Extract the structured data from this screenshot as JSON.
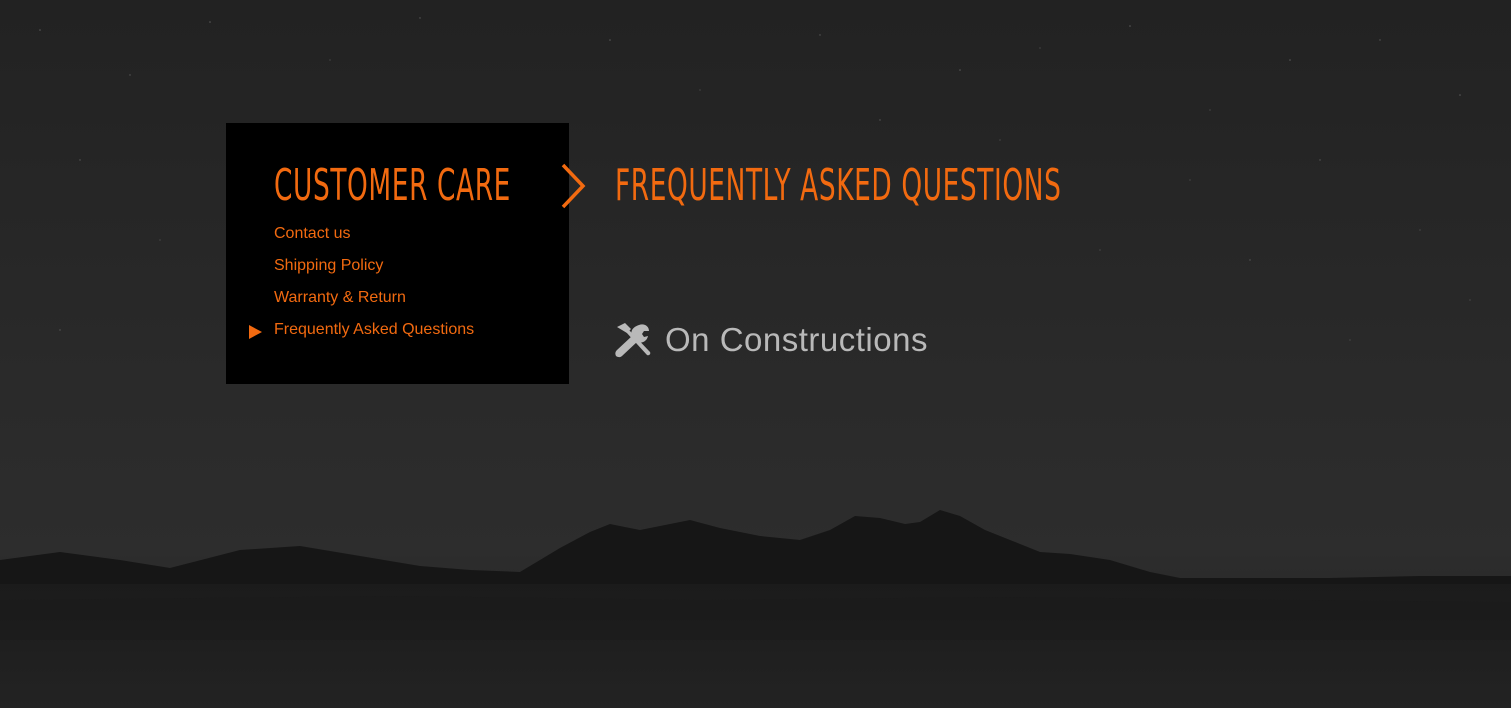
{
  "sidebar": {
    "title": "CUSTOMER CARE",
    "items": [
      {
        "label": "Contact us",
        "active": false
      },
      {
        "label": "Shipping Policy",
        "active": false
      },
      {
        "label": "Warranty & Return",
        "active": false
      },
      {
        "label": "Frequently Asked Questions",
        "active": true
      }
    ]
  },
  "header": {
    "separator_icon": "chevron-right-icon",
    "title": "FREQUENTLY ASKED QUESTIONS"
  },
  "main": {
    "section_icon": "tools-icon",
    "section_title": "On Constructions"
  },
  "colors": {
    "accent": "#f26a10",
    "panel": "#000000",
    "muted_text": "#b9b9b9",
    "background": "#262626"
  }
}
